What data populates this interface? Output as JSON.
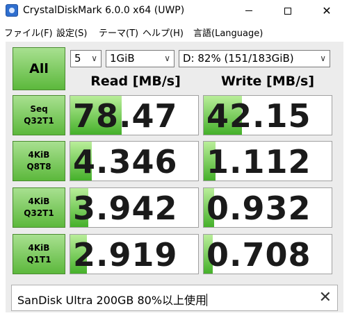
{
  "window": {
    "title": "CrystalDiskMark 6.0.0 x64 (UWP)",
    "minimize_glyph": "─",
    "maximize_glyph": "☐",
    "close_glyph": "✕"
  },
  "menu": {
    "items": [
      "ファイル(F)",
      "設定(S)",
      "テーマ(T)",
      "ヘルプ(H)",
      "言語(Language)"
    ]
  },
  "controls": {
    "all_label": "All",
    "count": "5",
    "size": "1GiB",
    "drive": "D: 82% (151/183GiB)"
  },
  "headers": {
    "read": "Read [MB/s]",
    "write": "Write [MB/s]"
  },
  "tests": [
    {
      "line1": "Seq",
      "line2": "Q32T1",
      "read": "78.47",
      "write": "42.15",
      "read_fill": 0.4,
      "write_fill": 0.3
    },
    {
      "line1": "4KiB",
      "line2": "Q8T8",
      "read": "4.346",
      "write": "1.112",
      "read_fill": 0.17,
      "write_fill": 0.09
    },
    {
      "line1": "4KiB",
      "line2": "Q32T1",
      "read": "3.942",
      "write": "0.932",
      "read_fill": 0.14,
      "write_fill": 0.08
    },
    {
      "line1": "4KiB",
      "line2": "Q1T1",
      "read": "2.919",
      "write": "0.708",
      "read_fill": 0.13,
      "write_fill": 0.07
    }
  ],
  "comment": {
    "text": "SanDisk Ultra 200GB 80%以上使用",
    "clear_glyph": "✕"
  },
  "colors": {
    "button_green": "#5cb83c",
    "bar_green": "#45b02a"
  }
}
